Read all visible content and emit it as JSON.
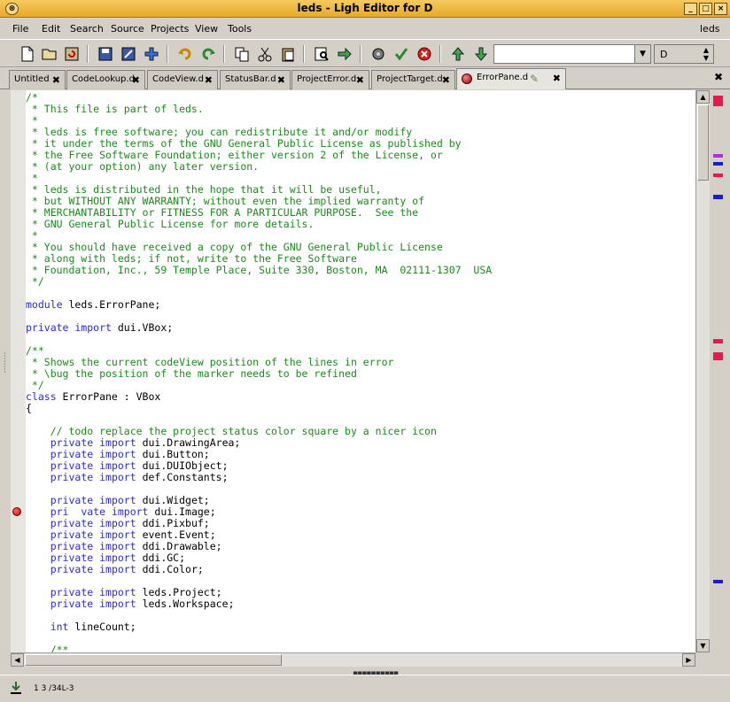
{
  "window": {
    "title": "leds - Ligh Editor for D"
  },
  "menu": {
    "items": [
      "File",
      "Edit",
      "Search",
      "Source",
      "Projects",
      "View",
      "Tools"
    ],
    "right": "leds"
  },
  "toolbar": {
    "search_value": "",
    "language_value": "D"
  },
  "tabs": [
    {
      "label": "Untitled"
    },
    {
      "label": "CodeLookup.d"
    },
    {
      "label": "CodeView.d"
    },
    {
      "label": "StatusBar.d"
    },
    {
      "label": "ProjectError.d"
    },
    {
      "label": "ProjectTarget.d"
    },
    {
      "label": "ErrorPane.d"
    }
  ],
  "editor": {
    "lines": [
      [
        "c",
        "/*"
      ],
      [
        "c",
        " * This file is part of leds."
      ],
      [
        "c",
        " *"
      ],
      [
        "c",
        " * leds is free software; you can redistribute it and/or modify"
      ],
      [
        "c",
        " * it under the terms of the GNU General Public License as published by"
      ],
      [
        "c",
        " * the Free Software Foundation; either version 2 of the License, or"
      ],
      [
        "c",
        " * (at your option) any later version."
      ],
      [
        "c",
        " *"
      ],
      [
        "c",
        " * leds is distributed in the hope that it will be useful,"
      ],
      [
        "c",
        " * but WITHOUT ANY WARRANTY; without even the implied warranty of"
      ],
      [
        "c",
        " * MERCHANTABILITY or FITNESS FOR A PARTICULAR PURPOSE.  See the"
      ],
      [
        "c",
        " * GNU General Public License for more details."
      ],
      [
        "c",
        " *"
      ],
      [
        "c",
        " * You should have received a copy of the GNU General Public License"
      ],
      [
        "c",
        " * along with leds; if not, write to the Free Software"
      ],
      [
        "c",
        " * Foundation, Inc., 59 Temple Place, Suite 330, Boston, MA  02111-1307  USA"
      ],
      [
        "c",
        " */"
      ],
      [
        "n",
        ""
      ],
      [
        "k",
        "module",
        " leds.ErrorPane;"
      ],
      [
        "n",
        ""
      ],
      [
        "k",
        "private import",
        " dui.VBox;"
      ],
      [
        "n",
        ""
      ],
      [
        "c",
        "/**"
      ],
      [
        "c",
        " * Shows the current codeView position of the lines in error"
      ],
      [
        "c",
        " * \\bug the position of the marker needs to be refined"
      ],
      [
        "c",
        " */"
      ],
      [
        "k",
        "class",
        " ErrorPane : VBox"
      ],
      [
        "n",
        "{"
      ],
      [
        "n",
        ""
      ],
      [
        "c",
        "    // todo replace the project status color square by a nicer icon"
      ],
      [
        "ki",
        "    ",
        "private import",
        " dui.DrawingArea;"
      ],
      [
        "ki",
        "    ",
        "private import",
        " dui.Button;"
      ],
      [
        "ki",
        "    ",
        "private import",
        " dui.DUIObject;"
      ],
      [
        "ki",
        "    ",
        "private import",
        " def.Constants;"
      ],
      [
        "n",
        ""
      ],
      [
        "ki",
        "    ",
        "private import",
        " dui.Widget;"
      ],
      [
        "ki",
        "    ",
        "pri  vate import",
        " dui.Image;"
      ],
      [
        "ki",
        "    ",
        "private import",
        " ddi.Pixbuf;"
      ],
      [
        "ki",
        "    ",
        "private import",
        " event.Event;"
      ],
      [
        "ki",
        "    ",
        "private import",
        " ddi.Drawable;"
      ],
      [
        "ki",
        "    ",
        "private import",
        " ddi.GC;"
      ],
      [
        "ki",
        "    ",
        "private import",
        " ddi.Color;"
      ],
      [
        "n",
        ""
      ],
      [
        "ki",
        "    ",
        "private import",
        " leds.Project;"
      ],
      [
        "ki",
        "    ",
        "private import",
        " leds.Workspace;"
      ],
      [
        "n",
        ""
      ],
      [
        "ki",
        "    ",
        "int",
        " lineCount;"
      ],
      [
        "n",
        ""
      ],
      [
        "c",
        "    /**"
      ]
    ]
  },
  "markers": [
    {
      "offset": 6,
      "height": 12,
      "color": "#e8194c"
    },
    {
      "offset": 72,
      "height": 4,
      "color": "#b52be0"
    },
    {
      "offset": 81,
      "height": 4,
      "color": "#1a1ad8"
    },
    {
      "offset": 94,
      "height": 4,
      "color": "#e8194c"
    },
    {
      "offset": 118,
      "height": 5,
      "color": "#1a1ad8"
    },
    {
      "offset": 281,
      "height": 5,
      "color": "#e8194c"
    },
    {
      "offset": 296,
      "height": 9,
      "color": "#e8194c"
    },
    {
      "offset": 553,
      "height": 4,
      "color": "#1a1ad8"
    }
  ],
  "status": {
    "position": "1 3 /34L-3"
  },
  "colors": {
    "comment": "#1a8c1a",
    "keyword": "#2b2bd6",
    "titlebar": "#e5a92c"
  }
}
